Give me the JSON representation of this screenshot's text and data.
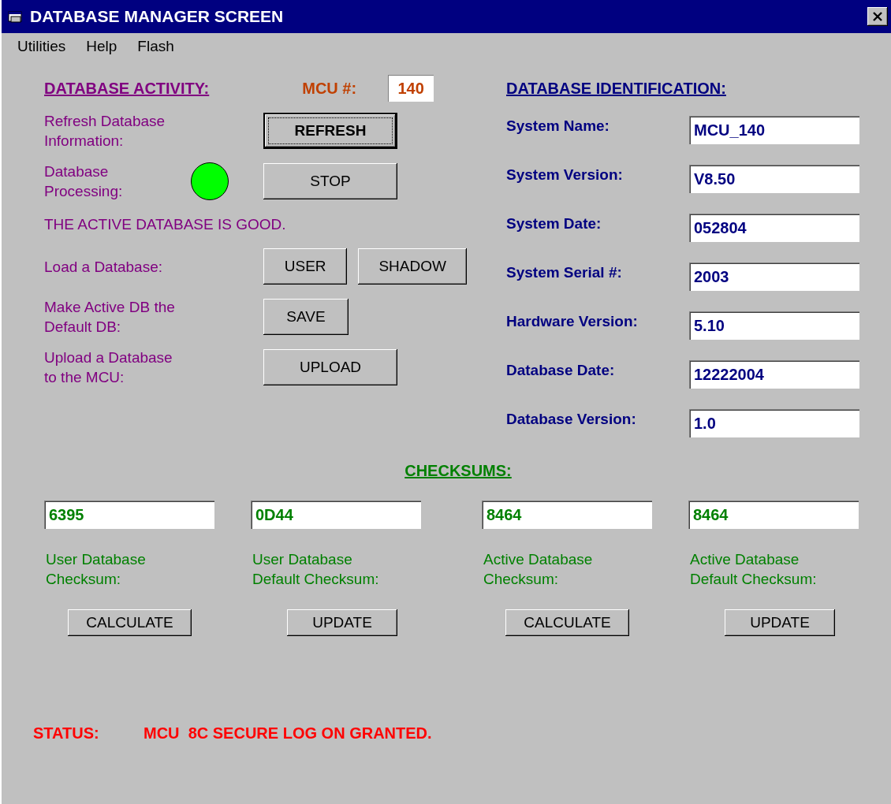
{
  "window": {
    "title": "DATABASE MANAGER SCREEN"
  },
  "menu": [
    "Utilities",
    "Help",
    "Flash"
  ],
  "activity": {
    "heading": "DATABASE ACTIVITY:",
    "mcu_label": "MCU #:",
    "mcu_value": "140",
    "rows": [
      {
        "kind": "buttons",
        "label": "Refresh Database\nInformation:",
        "buttons": [
          {
            "label": "REFRESH",
            "focused": true,
            "wide": true
          }
        ]
      },
      {
        "kind": "indicator",
        "label": "Database\nProcessing:",
        "color": "#00ff00",
        "buttons": [
          {
            "label": "STOP",
            "focused": false,
            "wide": true
          }
        ]
      },
      {
        "kind": "message",
        "label": "THE ACTIVE DATABASE IS GOOD."
      },
      {
        "kind": "buttons",
        "label": "Load a Database:",
        "buttons": [
          {
            "label": "USER",
            "focused": false,
            "wide": false
          },
          {
            "label": "SHADOW",
            "focused": false,
            "wide": false
          }
        ]
      },
      {
        "kind": "buttons",
        "label": "Make Active DB the\nDefault DB:",
        "buttons": [
          {
            "label": "SAVE",
            "focused": false,
            "wide": false
          }
        ]
      },
      {
        "kind": "buttons",
        "label": "Upload a Database\nto the MCU:",
        "buttons": [
          {
            "label": "UPLOAD",
            "focused": false,
            "wide": true
          }
        ]
      }
    ]
  },
  "identification": {
    "heading": "DATABASE IDENTIFICATION:",
    "fields": [
      {
        "label": "System Name:",
        "value": "MCU_140"
      },
      {
        "label": "System Version:",
        "value": "V8.50"
      },
      {
        "label": "System Date:",
        "value": "052804"
      },
      {
        "label": "System Serial #:",
        "value": "2003"
      },
      {
        "label": "Hardware Version:",
        "value": "5.10"
      },
      {
        "label": "Database Date:",
        "value": "12222004"
      },
      {
        "label": "Database Version:",
        "value": "1.0"
      }
    ]
  },
  "checksums": {
    "heading": "CHECKSUMS:",
    "items": [
      {
        "value": "6395",
        "label": "User Database\nChecksum:",
        "button": "CALCULATE"
      },
      {
        "value": "0D44",
        "label": "User Database\nDefault Checksum:",
        "button": "UPDATE"
      },
      {
        "value": "8464",
        "label": "Active Database\nChecksum:",
        "button": "CALCULATE"
      },
      {
        "value": "8464",
        "label": "Active Database\nDefault Checksum:",
        "button": "UPDATE"
      }
    ]
  },
  "status": {
    "label": "STATUS:",
    "message": "MCU  8C SECURE LOG ON GRANTED."
  }
}
